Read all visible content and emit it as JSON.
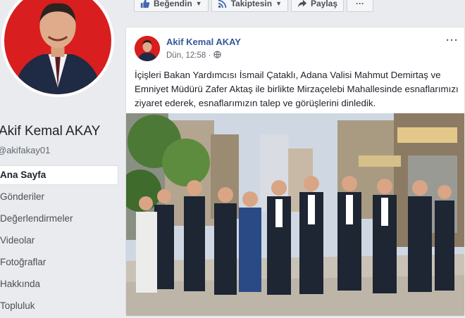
{
  "profile": {
    "name": "Akif Kemal AKAY",
    "handle": "@akifakay01"
  },
  "nav": {
    "items": [
      {
        "label": "Ana Sayfa"
      },
      {
        "label": "Gönderiler"
      },
      {
        "label": "Değerlendirmeler"
      },
      {
        "label": "Videolar"
      },
      {
        "label": "Fotoğraflar"
      },
      {
        "label": "Hakkında"
      },
      {
        "label": "Topluluk"
      }
    ]
  },
  "actions": {
    "like": "Beğendin",
    "follow": "Takiptesin",
    "share": "Paylaş",
    "more": "···"
  },
  "post": {
    "author": "Akif Kemal AKAY",
    "time": "Dün, 12:58 ·",
    "more": "···",
    "text": "İçişleri Bakan Yardımcısı İsmail Çataklı, Adana Valisi Mahmut Demirtaş ve Emniyet Müdürü Zafer Aktaş ile birlikte Mirzaçelebi Mahallesinde esnaflarımızı ziyaret ederek, esnaflarımızın talep ve görüşlerini dinledik."
  },
  "colors": {
    "brand": "#4267b2",
    "link": "#365899",
    "profile_bg": "#d81e1e"
  },
  "icons": {
    "like": "thumbs-up-icon",
    "follow": "rss-icon",
    "share": "share-arrow-icon",
    "privacy": "globe-icon"
  }
}
